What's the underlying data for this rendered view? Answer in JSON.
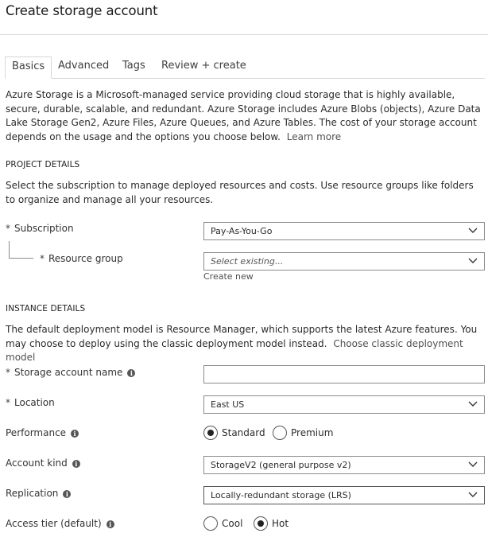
{
  "page": {
    "title": "Create storage account"
  },
  "tabs": [
    {
      "label": "Basics",
      "active": true
    },
    {
      "label": "Advanced",
      "active": false
    },
    {
      "label": "Tags",
      "active": false
    },
    {
      "label": "Review + create",
      "active": false
    }
  ],
  "intro": {
    "text": "Azure Storage is a Microsoft-managed service providing cloud storage that is highly available, secure, durable, scalable, and redundant. Azure Storage includes Azure Blobs (objects), Azure Data Lake Storage Gen2, Azure Files, Azure Queues, and Azure Tables. The cost of your storage account depends on the usage and the options you choose below.",
    "link": "Learn more"
  },
  "project": {
    "heading": "PROJECT DETAILS",
    "description": "Select the subscription to manage deployed resources and costs. Use resource groups like folders to organize and manage all your resources.",
    "subscription": {
      "label": "Subscription",
      "value": "Pay-As-You-Go"
    },
    "resource_group": {
      "label": "Resource group",
      "placeholder": "Select existing...",
      "create_link": "Create new"
    }
  },
  "instance": {
    "heading": "INSTANCE DETAILS",
    "description": "The default deployment model is Resource Manager, which supports the latest Azure features. You may choose to deploy using the classic deployment model instead.",
    "link": "Choose classic deployment model",
    "storage_name": {
      "label": "Storage account name",
      "value": ""
    },
    "location": {
      "label": "Location",
      "value": "East US"
    },
    "performance": {
      "label": "Performance",
      "options": [
        "Standard",
        "Premium"
      ],
      "selected": "Standard"
    },
    "account_kind": {
      "label": "Account kind",
      "value": "StorageV2 (general purpose v2)"
    },
    "replication": {
      "label": "Replication",
      "value": "Locally-redundant storage (LRS)"
    },
    "access_tier": {
      "label": "Access tier (default)",
      "options": [
        "Cool",
        "Hot"
      ],
      "selected": "Hot"
    }
  },
  "glyphs": {
    "required": "*",
    "info": "i"
  },
  "icons": {
    "dropdown": "chevron-down-icon",
    "info": "info-icon"
  },
  "colors": {
    "text": "#323130",
    "border": "#8a8a8a",
    "link": "#505050"
  }
}
